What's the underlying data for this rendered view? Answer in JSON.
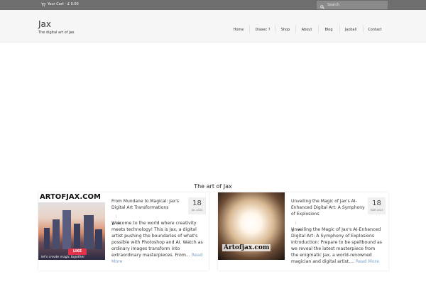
{
  "topbar": {
    "cart_label": "Your Cart - £ 0.00",
    "search_placeholder": "Search"
  },
  "header": {
    "site_title": "Jax",
    "tagline": "The digital art of Jax"
  },
  "nav": {
    "items": [
      "Home",
      "Diasec ?",
      "Shop",
      "About",
      "Blog",
      "Jaxball",
      "Contact"
    ]
  },
  "section": {
    "title": "The art of Jax"
  },
  "posts": [
    {
      "title": "From Mundane to Magical: Jax's Digital Art Transformations",
      "date_day": "18",
      "date_month": "JUL 2023",
      "excerpt": "Welcome to the world where creativity meets technology! This is Jax, a digital artist pushing the boundaries of what's possible with Photoshop and AI. Watch as ordinary images transform into extraordinary masterpieces. From...",
      "read_more": "Read More",
      "image_logo": "ARTOFJAX.COM",
      "image_button": "LIKE",
      "image_caption": "let's create magic together"
    },
    {
      "title": "Unveiling the Magic of Jax's AI-Enhanced Digital Art: A Symphony of Explosions",
      "date_day": "18",
      "date_month": "MAR 2023",
      "excerpt": "Unveiling the Magic of Jax's AI-Enhanced Digital Art: A Symphony of Explosions Introduction: Prepare to be spellbound as we reveal the latest masterpiece from the enigmatic Jax, a world-renowned magician and digital artist....",
      "read_more": "Read More",
      "image_logo": "Artofjax.com"
    }
  ]
}
